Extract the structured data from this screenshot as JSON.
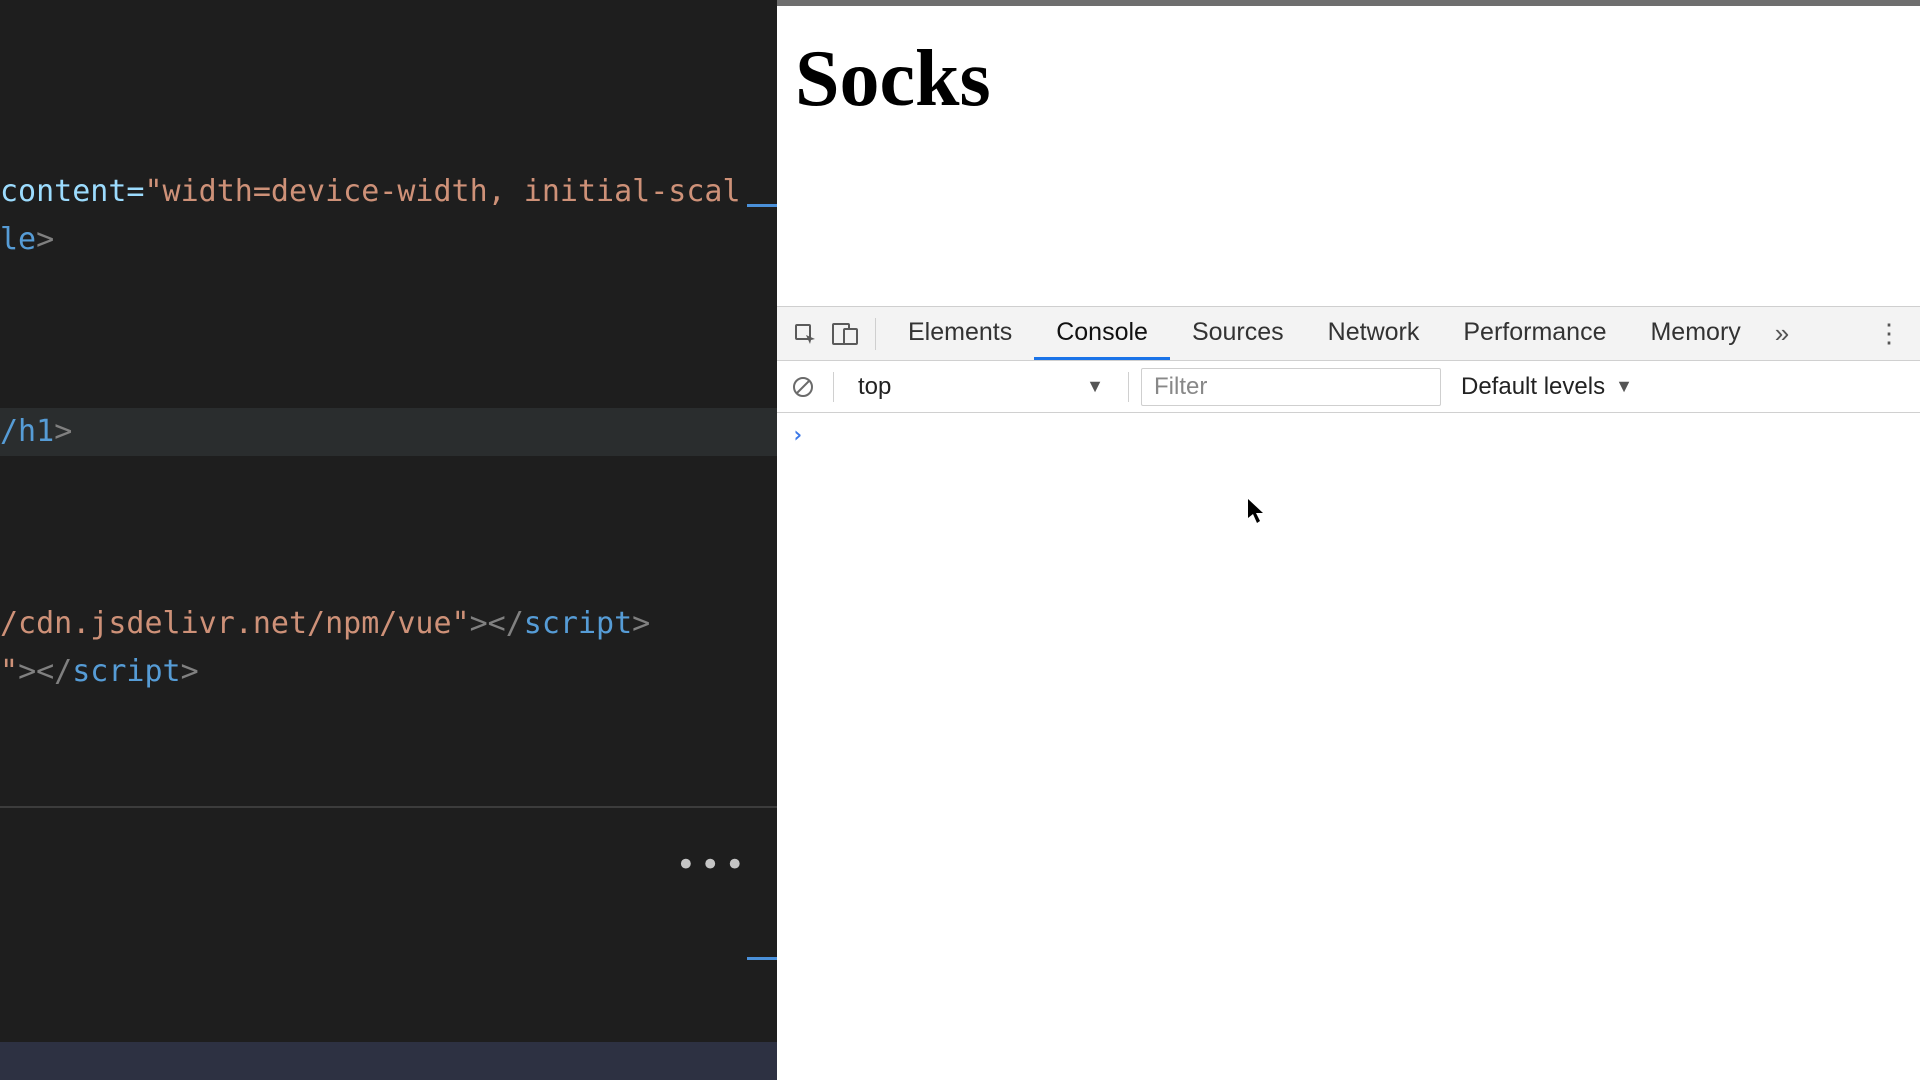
{
  "editor": {
    "lines": {
      "l1a": "content=",
      "l1b": "\"width=device-width, initial-scal",
      "l2a": "le",
      "l2b": ">",
      "l3a": "/h1",
      "l3b": ">",
      "l4a": "/cdn.jsdelivr.net/npm/vue\"",
      "l4b": "></",
      "l4c": "script",
      "l4d": ">",
      "l5a": "\"",
      "l5b": "></",
      "l5c": "script",
      "l5d": ">"
    },
    "more_glyph": "•••"
  },
  "page": {
    "heading": "Socks"
  },
  "devtools": {
    "tabs": {
      "elements": "Elements",
      "console": "Console",
      "sources": "Sources",
      "network": "Network",
      "performance": "Performance",
      "memory": "Memory"
    },
    "overflow_glyph": "»",
    "kebab_glyph": "⋮",
    "toolbar": {
      "context": "top",
      "filter_placeholder": "Filter",
      "levels": "Default levels"
    },
    "prompt_glyph": "›"
  }
}
